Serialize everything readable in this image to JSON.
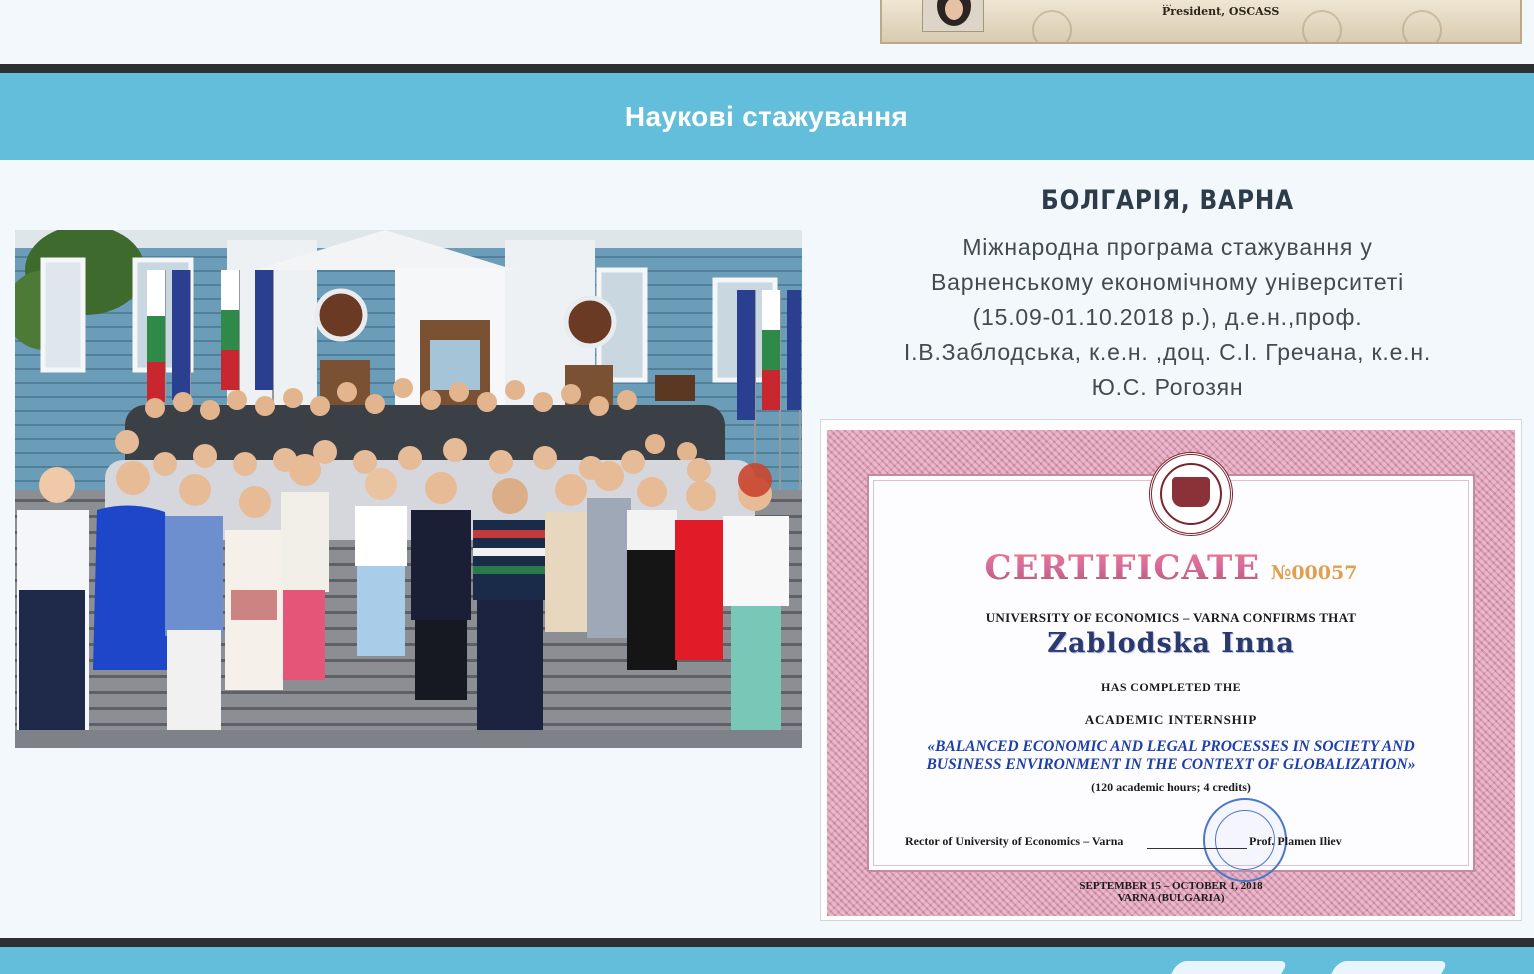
{
  "section": {
    "title": "Наукові стажування"
  },
  "internship": {
    "location": "БОЛГАРІЯ, ВАРНА",
    "description_lines": [
      "Міжнародна програма стажування у",
      "Варненському економічному університеті",
      "(15.09-01.10.2018 р.), д.е.н.,проф.",
      "І.В.Заблодська, к.е.н. ,доц. С.І. Гречана, к.е.н.",
      "Ю.С. Рогозян"
    ]
  },
  "previous_certificate": {
    "signature_text": "…",
    "president_label": "President, OSCASS"
  },
  "certificate": {
    "title": "CERTIFICATE",
    "number": "№00057",
    "confirms": "UNIVERSITY OF ECONOMICS – VARNA CONFIRMS THAT",
    "recipient": "Zablodska Inna",
    "completed": "HAS COMPLETED THE",
    "type": "ACADEMIC INTERNSHIP",
    "program_line1": "«BALANCED ECONOMIC AND LEGAL PROCESSES IN SOCIETY AND",
    "program_line2": "BUSINESS ENVIRONMENT IN THE CONTEXT OF GLOBALIZATION»",
    "hours": "(120 academic hours; 4 credits)",
    "rector_label": "Rector of University of Economics – Varna",
    "rector_name": "Prof. Plamen Iliev",
    "dates": "SEPTEMBER 15 – OCTOBER 1, 2018",
    "place": "VARNA (BULGARIA)"
  },
  "colors": {
    "accent_bar": "#63bedb",
    "divider": "#2d2f33",
    "page_bg": "#f2f8fc",
    "heading_text": "#2e3b4a",
    "body_text": "#444a52"
  }
}
